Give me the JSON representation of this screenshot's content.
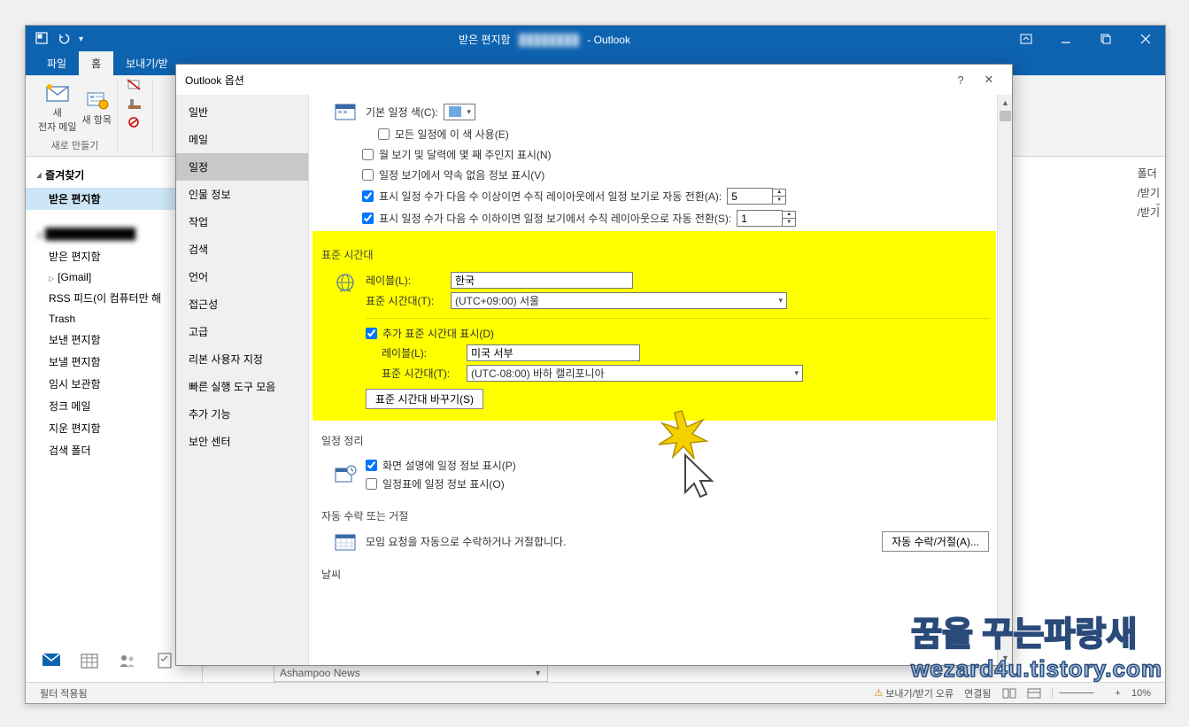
{
  "titlebar": {
    "title": "받은 편지함",
    "app": "- Outlook"
  },
  "ribbon": {
    "tabs": [
      "파일",
      "홈",
      "보내기/받"
    ],
    "group1_labels": [
      "새\n전자 메일",
      "새 항목"
    ],
    "group1_name": "새로 만들기"
  },
  "folderPane": {
    "favorites": "즐겨찾기",
    "inbox_sel": "받은 편지함",
    "account_blur": "████████████",
    "items": [
      "받은 편지함",
      "[Gmail]",
      "RSS 피드(이 컴퓨터만 해",
      "Trash",
      "보낸 편지함",
      "보낼 편지함",
      "임시 보관함",
      "정크 메일",
      "지운 편지함",
      "검색 폴더"
    ]
  },
  "rightRemnant": {
    "l1": "폴더",
    "l2": "/받기",
    "l3": "/받기"
  },
  "dialog": {
    "title": "Outlook 옵션",
    "nav": [
      "일반",
      "메일",
      "일정",
      "인물 정보",
      "작업",
      "검색",
      "언어",
      "접근성",
      "고급",
      "리본 사용자 지정",
      "빠른 실행 도구 모음",
      "추가 기능",
      "보안 센터"
    ],
    "nav_active": 2,
    "defColor_label": "기본 일정 색(C):",
    "cb_allCal": "모든 일정에 이 색 사용(E)",
    "cb_weekNum": "월 보기 및 달력에 몇 째 주인지 표시(N)",
    "cb_noAppt": "일정 보기에서 약속 없음 정보 표시(V)",
    "cb_autoVert": "표시 일정 수가 다음 수 이상이면 수직 레이아웃에서 일정 보기로 자동 전환(A):",
    "spin1": "5",
    "cb_autoVert2": "표시 일정 수가 다음 수 이하이면 일정 보기에서 수직 레이아웃으로 자동 전환(S):",
    "spin2": "1",
    "tz_header": "표준 시간대",
    "tz_label_l": "레이블(L):",
    "tz_label_v": "한국",
    "tz_tz_l": "표준 시간대(T):",
    "tz_tz_v": "(UTC+09:00) 서울",
    "tz_add_cb": "추가 표준 시간대 표시(D)",
    "tz_label2_l": "레이블(L):",
    "tz_label2_v": "미국 서부",
    "tz_tz2_l": "표준 시간대(T):",
    "tz_tz2_v": "(UTC-08:00) 바하 캘리포니아",
    "tz_swap_btn": "표준 시간대 바꾸기(S)",
    "sched_header": "일정 정리",
    "sched_cb1": "화면 설명에 일정 정보 표시(P)",
    "sched_cb2": "일정표에 일정 정보 표시(O)",
    "auto_header": "자동 수락 또는 거절",
    "auto_desc": "모임 요청을 자동으로 수락하거나 거절합니다.",
    "auto_btn": "자동 수락/거절(A)...",
    "weather_header": "날씨"
  },
  "statusbar": {
    "filter": "필터 적용됨",
    "sendrecv": "보내기/받기 오류",
    "conn": "연결됨",
    "zoom": "10%"
  },
  "ashampoo": "Ashampoo News",
  "watermark": {
    "l1": "꿈을 꾸는파랑새",
    "l2": "wezard4u.tistory.com"
  }
}
